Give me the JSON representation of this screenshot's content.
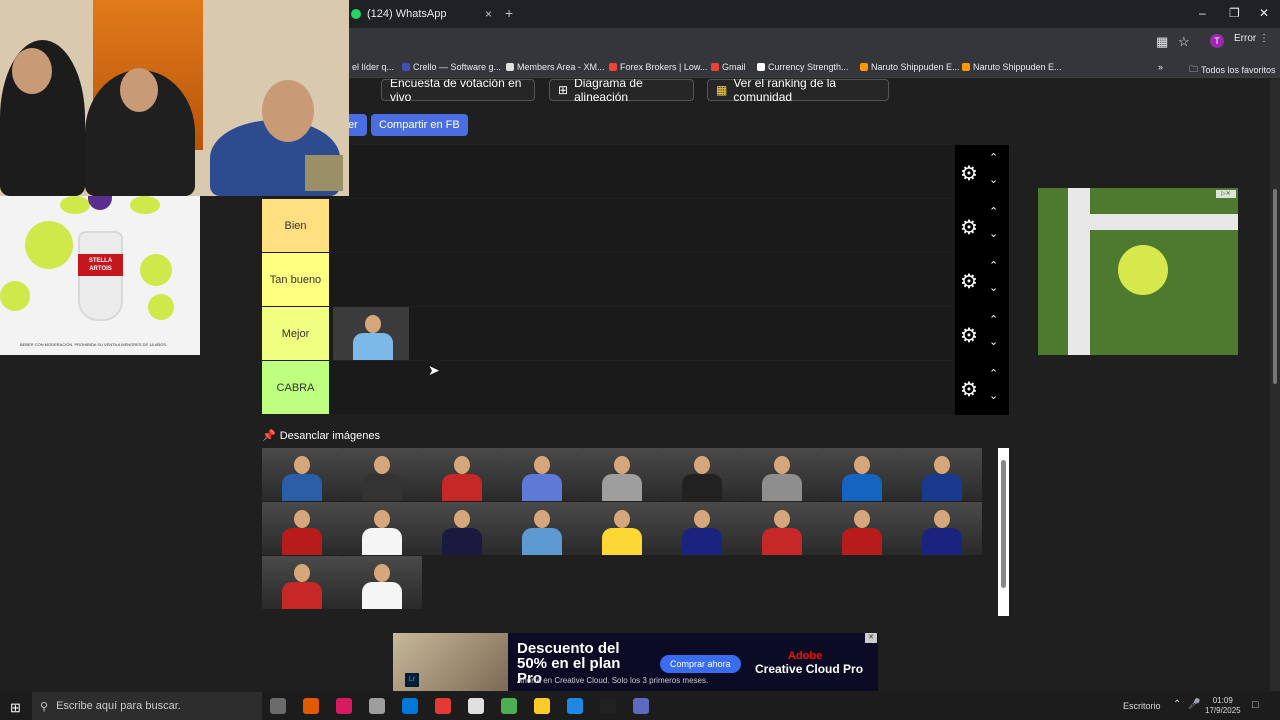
{
  "browser": {
    "tab_title": "(124) WhatsApp",
    "tab_close": "×",
    "new_tab": "+",
    "profile_initial": "T",
    "error_label": "Error",
    "bookmarks": [
      {
        "label": "el líder q...",
        "color": "#4caf50"
      },
      {
        "label": "Crello — Software g...",
        "color": "#3f51b5"
      },
      {
        "label": "Members Area - XM...",
        "color": "#e0e0e0"
      },
      {
        "label": "Forex Brokers | Low...",
        "color": "#f44336"
      },
      {
        "label": "Gmail",
        "color": "#ea4335"
      },
      {
        "label": "Currency Strength...",
        "color": "#ffffff"
      },
      {
        "label": "Naruto Shippuden E...",
        "color": "#ff9800"
      },
      {
        "label": "Naruto Shippuden E...",
        "color": "#ff9800"
      }
    ],
    "bookmarks_more": "»",
    "all_bookmarks": "Todos los favoritos"
  },
  "page": {
    "top_buttons": [
      {
        "label": "Encuesta de votación en vivo"
      },
      {
        "label": "Diagrama de alineación"
      },
      {
        "label": "Ver el ranking de la comunidad"
      }
    ],
    "partial_button": "er",
    "share_fb": "Compartir en FB",
    "tiers": [
      {
        "label": "",
        "color": "#ffbf7f"
      },
      {
        "label": "Bien",
        "color": "#ffdf80"
      },
      {
        "label": "Tan bueno",
        "color": "#ffff7f"
      },
      {
        "label": "Mejor",
        "color": "#f0ff7f"
      },
      {
        "label": "CABRA",
        "color": "#bfff7f"
      }
    ],
    "tier_up": "⌃",
    "tier_down": "⌄",
    "gear": "⚙",
    "unpin_label": "Desanclar imágenes",
    "pin_icon": "📌",
    "pool_colors": [
      [
        "#2a5fa8",
        "#333333",
        "#c62828",
        "#5f7ad6",
        "#9e9e9e",
        "#212121",
        "#8e8e8e",
        "#1565c0",
        "#1a3a8f"
      ],
      [
        "#b71c1c",
        "#f5f5f5",
        "#1a1a40",
        "#5d9ad1",
        "#fdd835",
        "#1a237e",
        "#c62828",
        "#b71c1c",
        "#1a237e"
      ],
      [
        "#c62828",
        "#f5f5f5"
      ]
    ]
  },
  "bottom_ad": {
    "title": "Descuento del 50% en el plan Pro",
    "subtitle": "Ahorra en Creative Cloud. Solo los 3 primeros meses.",
    "cta": "Comprar ahora",
    "brand": "Adobe",
    "product": "Creative Cloud Pro"
  },
  "cam_ad": {
    "brand": "STELLA ARTOIS",
    "legal": "BEBER CON MODERACIÓN. PROHIBIDA SU VENTA A MENORES DE 18 AÑOS."
  },
  "taskbar": {
    "search_placeholder": "Escribe aquí para buscar.",
    "desktop_label": "Escritorio",
    "time": "01:09",
    "date": "17/9/2025",
    "app_colors": [
      "#6b6b6b",
      "#e05a00",
      "#d81b60",
      "#9e9e9e",
      "#0078d7",
      "#e53935",
      "#e0e0e0",
      "#4caf50",
      "#ffca28",
      "#1e88e5",
      "#212121",
      "#5c6bc0"
    ]
  }
}
